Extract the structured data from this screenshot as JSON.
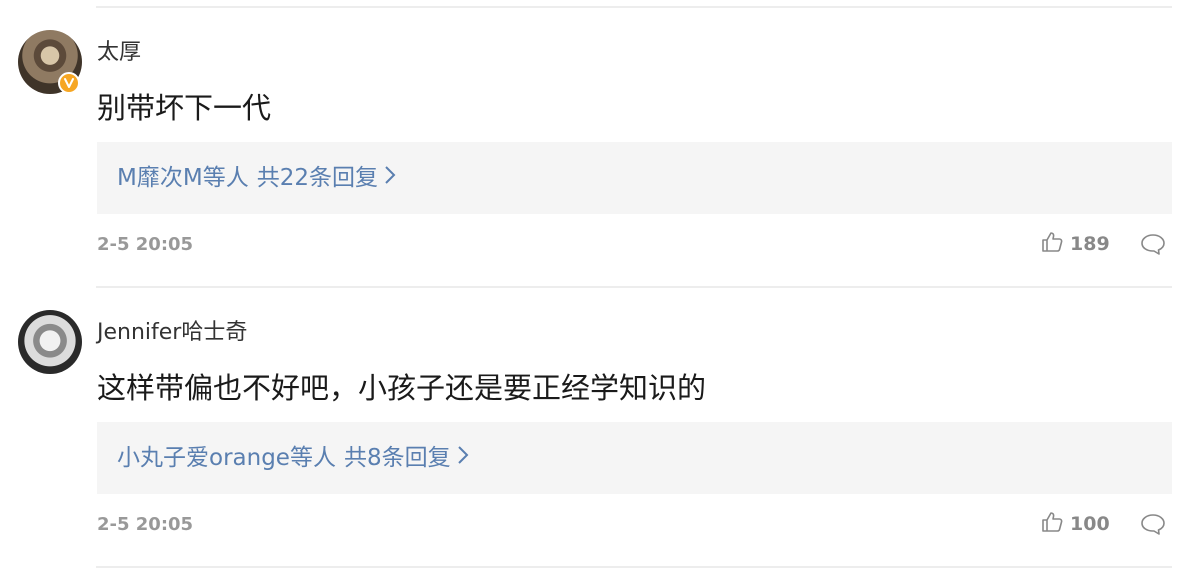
{
  "comments": [
    {
      "username": "太厚",
      "verified": true,
      "text": "别带坏下一代",
      "replies": {
        "users": "M靡次M等人",
        "count_text": "共22条回复"
      },
      "time": "2-5 20:05",
      "likes": "189"
    },
    {
      "username": "Jennifer哈士奇",
      "verified": false,
      "text": "这样带偏也不好吧，小孩子还是要正经学知识的",
      "replies": {
        "users": "小丸子爱orange等人",
        "count_text": "共8条回复"
      },
      "time": "2-5 20:05",
      "likes": "100"
    }
  ],
  "colors": {
    "link": "#5a7fb0",
    "verified_badge": "#f6a623",
    "muted": "#999999",
    "reply_bg": "#f5f5f5"
  },
  "icons": [
    "verified-badge-icon",
    "chevron-right-icon",
    "thumbs-up-icon",
    "comment-bubble-icon"
  ]
}
